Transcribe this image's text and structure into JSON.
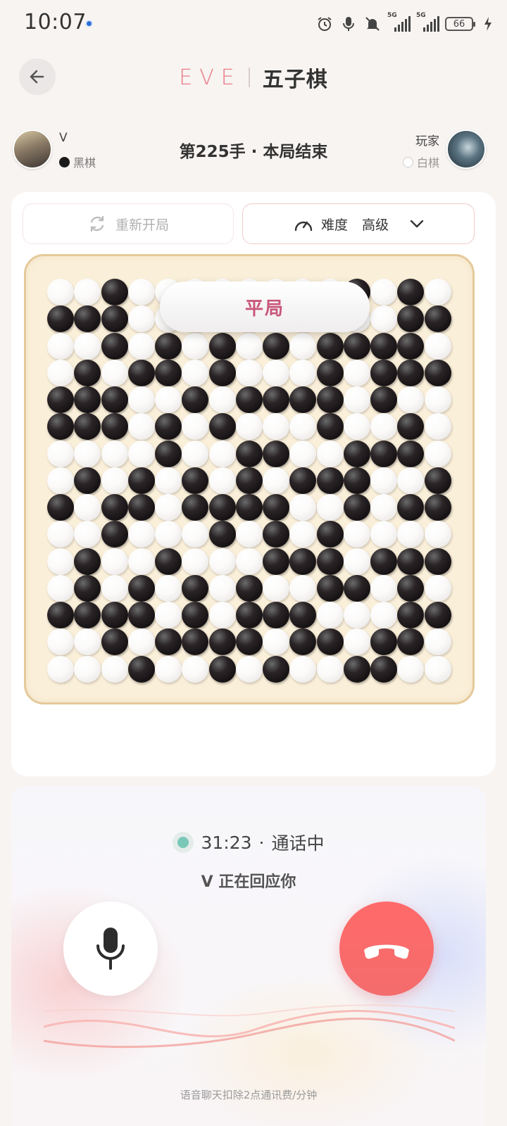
{
  "status_bar": {
    "time": "10:07",
    "network_label_1": "5G",
    "network_label_2": "5G",
    "battery": "66"
  },
  "header": {
    "brand": "EVE",
    "title": "五子棋"
  },
  "players": {
    "left": {
      "name": "V",
      "stone_label": "黑棋"
    },
    "right": {
      "name": "玩家",
      "stone_label": "白棋"
    },
    "move_status": "第225手 · 本局结束"
  },
  "controls": {
    "restart_label": "重新开局",
    "difficulty_label": "难度",
    "difficulty_value": "高级"
  },
  "board": {
    "result": "平局",
    "rows": [
      "WWBWWWWWWWWBWBW",
      "BBBWWWWWWWWWWBB",
      "WWBWBWBWBWBBBBW",
      "WBWBBWBWWWBWBBB",
      "BBBWWBWBBBBWBWW",
      "BBBWBWBWWWBWWBW",
      "WWWWBWWBBWWBBBW",
      "WBWBWBWBWBBBWWB",
      "BWBBWBBBBWWBWBB",
      "WWBWWWBWBWBWWWW",
      "WBWWBWWWBBBWBBB",
      "WBWBWBWBWWBBWBW",
      "BBBBWBWBBBWWWBB",
      "WWBWBBBBWBBWBBW",
      "WWWBWWBWBWWBBWW"
    ]
  },
  "call": {
    "duration": "31:23",
    "separator": "·",
    "state": "通话中",
    "responding_text": "V 正在回应你",
    "fee_note": "语音聊天扣除2点通讯费/分钟"
  }
}
